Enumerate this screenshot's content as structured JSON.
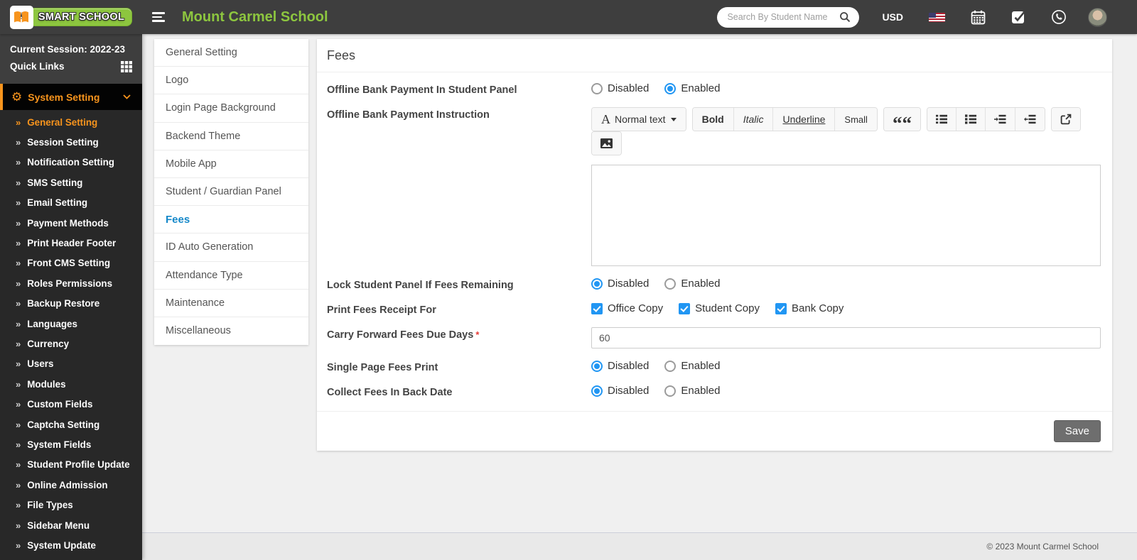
{
  "header": {
    "brand": "SMART SCHOOL",
    "school_name": "Mount Carmel School",
    "search_placeholder": "Search By Student Name",
    "currency": "USD",
    "icons": [
      "us-flag-icon",
      "calendar-icon",
      "task-check-icon",
      "whatsapp-icon",
      "avatar"
    ]
  },
  "sidebar": {
    "session_label": "Current Session: 2022-23",
    "quick_links_label": "Quick Links",
    "menu_title": "System Setting",
    "active_item": "General Setting",
    "items": [
      "General Setting",
      "Session Setting",
      "Notification Setting",
      "SMS Setting",
      "Email Setting",
      "Payment Methods",
      "Print Header Footer",
      "Front CMS Setting",
      "Roles Permissions",
      "Backup Restore",
      "Languages",
      "Currency",
      "Users",
      "Modules",
      "Custom Fields",
      "Captcha Setting",
      "System Fields",
      "Student Profile Update",
      "Online Admission",
      "File Types",
      "Sidebar Menu",
      "System Update"
    ]
  },
  "settings_nav": {
    "active_item": "Fees",
    "items": [
      "General Setting",
      "Logo",
      "Login Page Background",
      "Backend Theme",
      "Mobile App",
      "Student / Guardian Panel",
      "Fees",
      "ID Auto Generation",
      "Attendance Type",
      "Maintenance",
      "Miscellaneous"
    ]
  },
  "main": {
    "title": "Fees",
    "save_label": "Save",
    "required_mark": "*",
    "fields": [
      {
        "label": "Offline Bank Payment In Student Panel",
        "type": "radio",
        "options": [
          "Disabled",
          "Enabled"
        ],
        "selected": "Enabled"
      },
      {
        "label": "Offline Bank Payment Instruction",
        "type": "editor"
      },
      {
        "label": "Lock Student Panel If Fees Remaining",
        "type": "radio",
        "options": [
          "Disabled",
          "Enabled"
        ],
        "selected": "Disabled"
      },
      {
        "label": "Print Fees Receipt For",
        "type": "checkbox",
        "options": [
          "Office Copy",
          "Student Copy",
          "Bank Copy"
        ],
        "checked": [
          "Office Copy",
          "Student Copy",
          "Bank Copy"
        ]
      },
      {
        "label": "Carry Forward Fees Due Days",
        "required": true,
        "type": "text",
        "value": "60"
      },
      {
        "label": "Single Page Fees Print",
        "type": "radio",
        "options": [
          "Disabled",
          "Enabled"
        ],
        "selected": "Disabled"
      },
      {
        "label": "Collect Fees In Back Date",
        "type": "radio",
        "options": [
          "Disabled",
          "Enabled"
        ],
        "selected": "Disabled"
      }
    ]
  },
  "editor": {
    "style_label": "Normal text",
    "format_buttons": [
      "Bold",
      "Italic",
      "Underline",
      "Small"
    ],
    "icon_groups": [
      [
        "quote-icon"
      ],
      [
        "unordered-list-icon",
        "ordered-list-icon",
        "outdent-icon",
        "indent-icon"
      ],
      [
        "share-icon"
      ],
      [
        "picture-icon"
      ]
    ]
  },
  "footer": {
    "copyright": "© 2023 Mount Carmel School"
  },
  "colors": {
    "header_bg": "#3e3e3e",
    "sidebar_bg": "#282828",
    "accent_orange": "#f7941d",
    "brand_green": "#8dc63f",
    "active_blue": "#1588c9",
    "control_blue": "#2196f3",
    "save_gray": "#6e6e6e"
  }
}
